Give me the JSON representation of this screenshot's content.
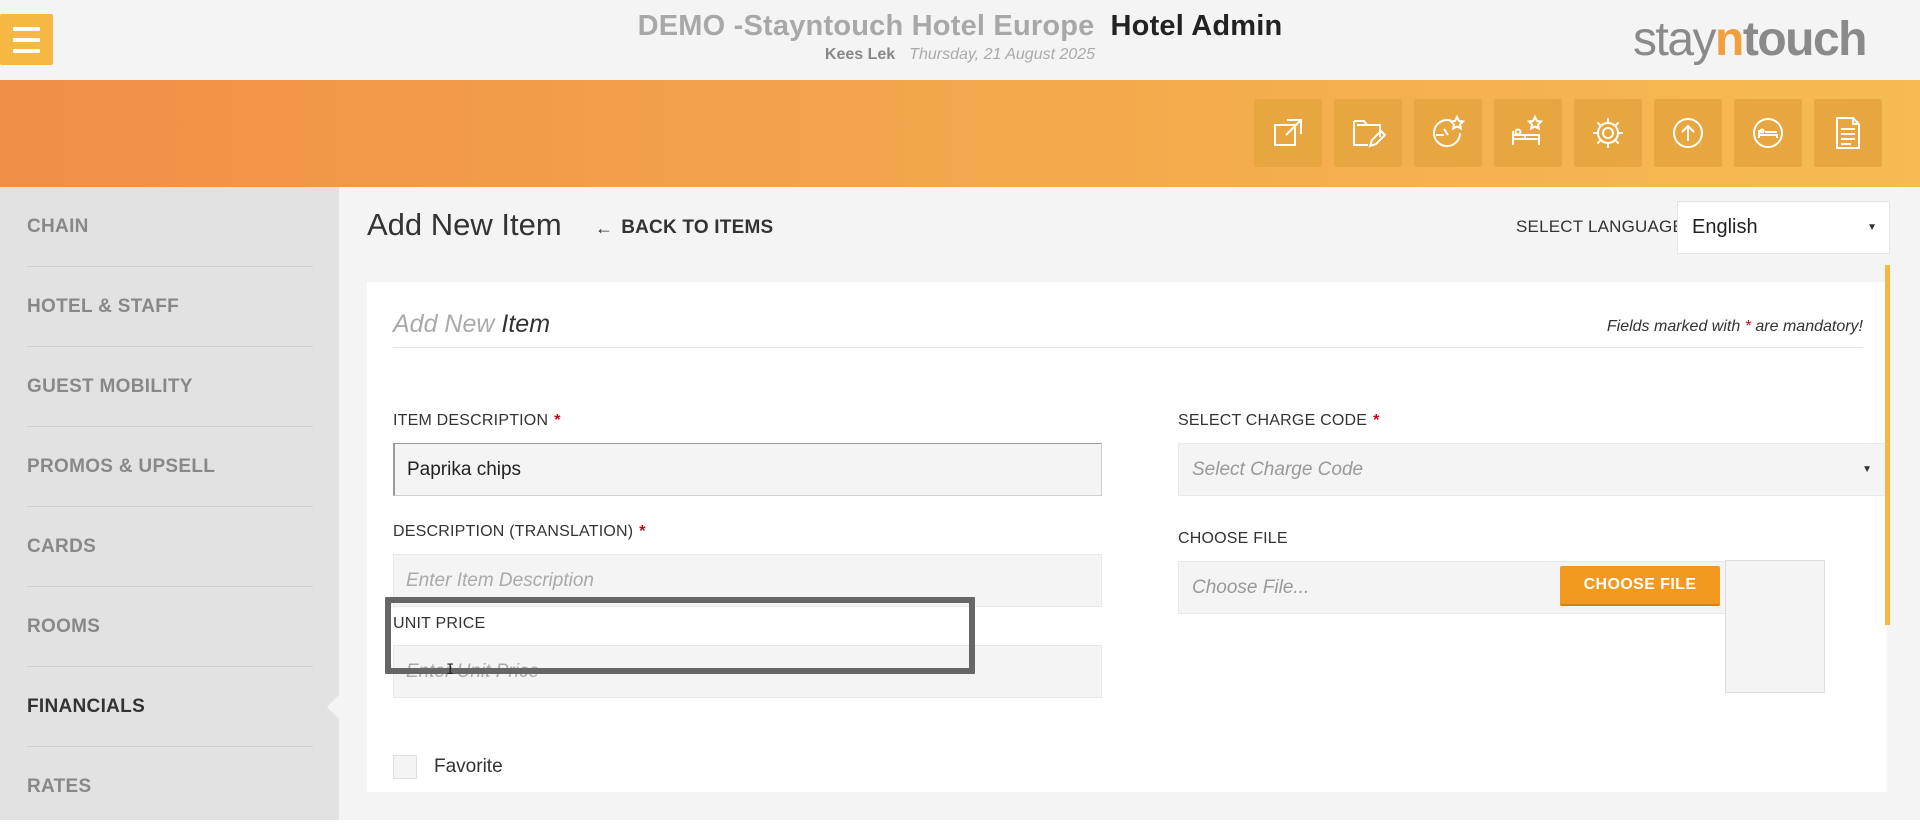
{
  "header": {
    "hotel_name": "DEMO -Stayntouch Hotel Europe",
    "app_title": "Hotel Admin",
    "user": "Kees Lek",
    "date": "Thursday, 21 August 2025",
    "logo": {
      "prefix": "stay",
      "mid": "n",
      "suffix": "touch"
    },
    "menu_icon": "hamburger-icon"
  },
  "toolbar": {
    "icons": [
      "external-link-icon",
      "folder-edit-icon",
      "dashboard-star-icon",
      "bed-star-icon",
      "gear-icon",
      "upload-circle-icon",
      "bed-circle-icon",
      "document-icon"
    ]
  },
  "sidebar": {
    "items": [
      {
        "label": "CHAIN",
        "active": false
      },
      {
        "label": "HOTEL & STAFF",
        "active": false
      },
      {
        "label": "GUEST MOBILITY",
        "active": false
      },
      {
        "label": "PROMOS & UPSELL",
        "active": false
      },
      {
        "label": "CARDS",
        "active": false
      },
      {
        "label": "ROOMS",
        "active": false
      },
      {
        "label": "FINANCIALS",
        "active": true
      },
      {
        "label": "RATES",
        "active": false
      }
    ]
  },
  "main": {
    "page_title": "Add New Item",
    "back_label": "BACK TO ITEMS",
    "back_icon": "arrow-left-icon",
    "language_label": "SELECT LANGUAGE",
    "language_value": "English"
  },
  "form": {
    "title_light": "Add New",
    "title_strong": "Item",
    "mandatory_pre": "Fields marked with",
    "mandatory_star": "*",
    "mandatory_post": "are mandatory!",
    "item_description": {
      "label": "ITEM DESCRIPTION",
      "star": "*",
      "value": "Paprika chips"
    },
    "translation": {
      "label": "DESCRIPTION (TRANSLATION)",
      "star": "*",
      "placeholder": "Enter Item Description"
    },
    "unit_price": {
      "label": "UNIT PRICE",
      "placeholder": "Enter Unit Price"
    },
    "charge_code": {
      "label": "SELECT CHARGE CODE",
      "star": "*",
      "placeholder": "Select Charge Code"
    },
    "choose_file": {
      "label": "CHOOSE FILE",
      "placeholder": "Choose File...",
      "button": "CHOOSE FILE"
    },
    "favorite": {
      "label": "Favorite",
      "checked": false
    }
  },
  "colors": {
    "accent": "#f5b843",
    "band_start": "#f08f47",
    "band_end": "#f6bb52",
    "button": "#f29a1f",
    "required": "#d0021b"
  }
}
